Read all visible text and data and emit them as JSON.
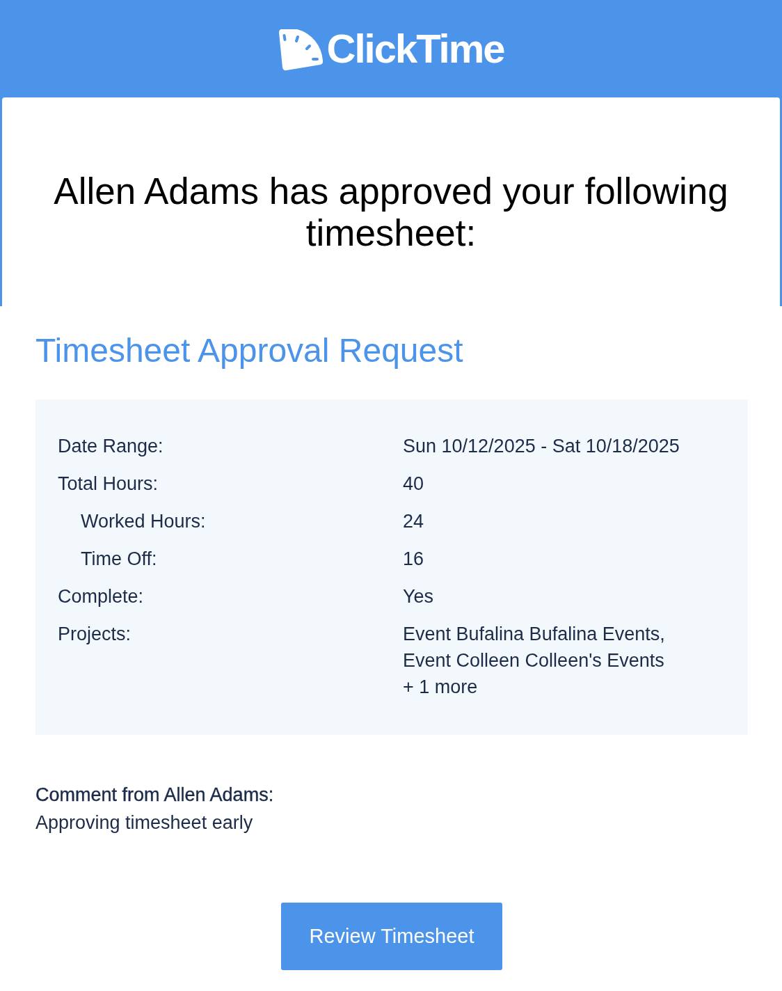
{
  "header": {
    "logo_text": "ClickTime"
  },
  "headline": "Allen Adams has approved your following timesheet:",
  "section_title": "Timesheet Approval Request",
  "details": [
    {
      "kind": "main",
      "label": "Date Range:",
      "lines": [
        "Sun 10/12/2025 - Sat 10/18/2025"
      ]
    },
    {
      "kind": "main",
      "label": "Total Hours:",
      "lines": [
        "40"
      ]
    },
    {
      "kind": "sub",
      "label": "Worked Hours:",
      "lines": [
        "24"
      ]
    },
    {
      "kind": "sub",
      "label": "Time Off:",
      "lines": [
        "16"
      ]
    },
    {
      "kind": "main",
      "label": "Complete:",
      "lines": [
        "Yes"
      ]
    },
    {
      "kind": "main",
      "label": "Projects:",
      "lines": [
        "Event Bufalina Bufalina Events,",
        "Event Colleen Colleen's Events",
        "+ 1 more"
      ]
    }
  ],
  "comment": {
    "heading": "Comment from Allen Adams:",
    "text": "Approving timesheet early"
  },
  "button": {
    "label": "Review Timesheet"
  }
}
